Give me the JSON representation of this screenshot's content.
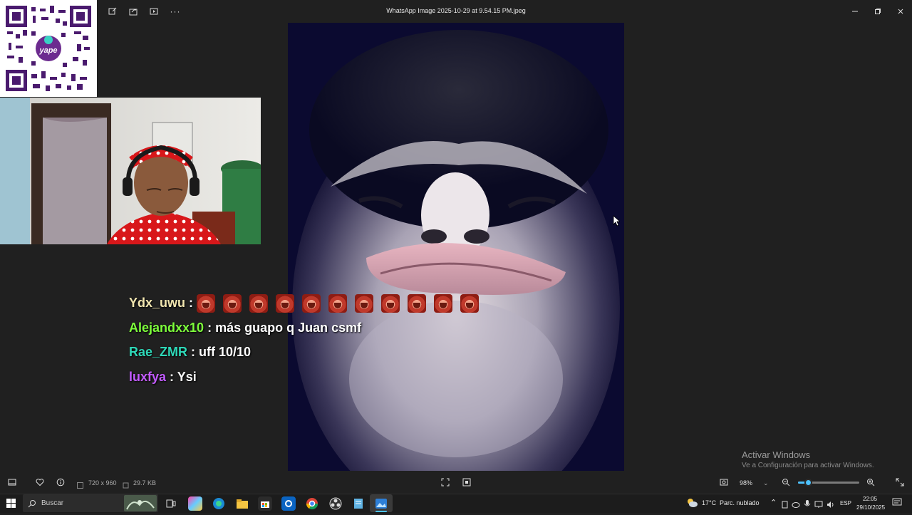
{
  "window": {
    "title": "WhatsApp Image 2025-10-29 at 9.54.15 PM.jpeg",
    "toolbar_icons": [
      "edit-icon",
      "share-icon",
      "slideshow-icon",
      "more-icon"
    ],
    "more_label": "···"
  },
  "qr": {
    "brand": "yape"
  },
  "chat": [
    {
      "user": "Ydx_uwu",
      "color": "#f2e6b0",
      "sep": " : ",
      "message": "",
      "emote_count": 11
    },
    {
      "user": "Alejandxx10",
      "color": "#7dff3b",
      "sep": " : ",
      "message": "más guapo q Juan csmf"
    },
    {
      "user": "Rae_ZMR",
      "color": "#2ed8b8",
      "sep": " : ",
      "message": "uff 10/10"
    },
    {
      "user": "luxfya",
      "color": "#c25bff",
      "sep": " : ",
      "message": "Ysi"
    }
  ],
  "watermark": {
    "title": "Activar Windows",
    "subtitle": "Ve a Configuración para activar Windows."
  },
  "bottombar": {
    "dimensions": "720 x 960",
    "filesize": "29.7 KB",
    "zoom": "98%",
    "zoom_value": 0.17
  },
  "taskbar": {
    "search_placeholder": "Buscar",
    "weather_temp": "17°C",
    "weather_desc": "Parc. nublado",
    "language": "ESP",
    "time": "22:05",
    "date": "29/10/2025"
  },
  "colors": {
    "accent": "#4cc2ff",
    "background": "#202020"
  }
}
